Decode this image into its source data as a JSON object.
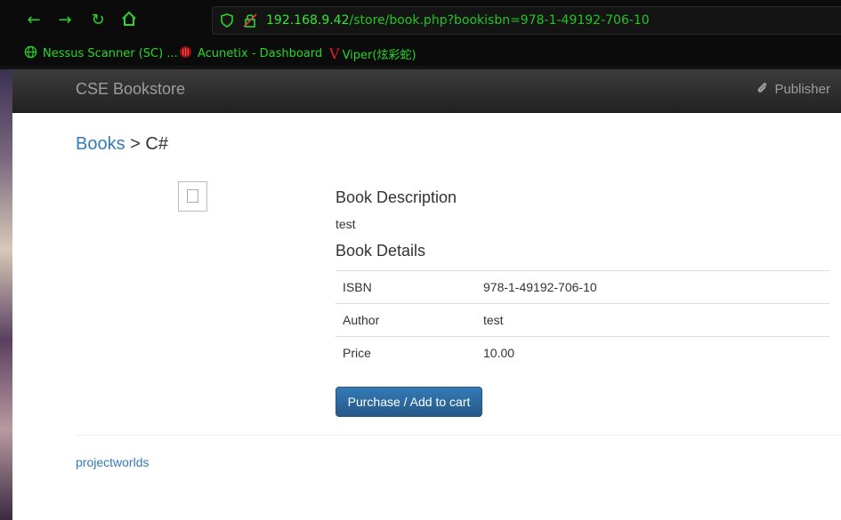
{
  "browser": {
    "url_host": "192.168.9.42",
    "url_path": "/store/book.php?bookisbn=978-1-49192-706-10",
    "bookmarks": [
      {
        "label": "Nessus Scanner (SC) ...",
        "icon": "globe-icon"
      },
      {
        "label": "Acunetix - Dashboard",
        "icon": "acunetix-icon"
      },
      {
        "label": "Viper(炫彩蛇)",
        "icon": "viper-icon"
      }
    ]
  },
  "navbar": {
    "brand": "CSE Bookstore",
    "publisher_label": "Publisher"
  },
  "breadcrumb": {
    "root": "Books",
    "separator": ">",
    "current": "C#"
  },
  "book": {
    "description_heading": "Book Description",
    "description": "test",
    "details_heading": "Book Details",
    "details": [
      {
        "key": "ISBN",
        "value": "978-1-49192-706-10"
      },
      {
        "key": "Author",
        "value": "test"
      },
      {
        "key": "Price",
        "value": "10.00"
      }
    ],
    "purchase_label": "Purchase / Add to cart"
  },
  "footer": {
    "link": "projectworlds"
  },
  "colors": {
    "link": "#337ab7",
    "navbar": "#222222",
    "chrome_accent": "#2bd62b"
  }
}
